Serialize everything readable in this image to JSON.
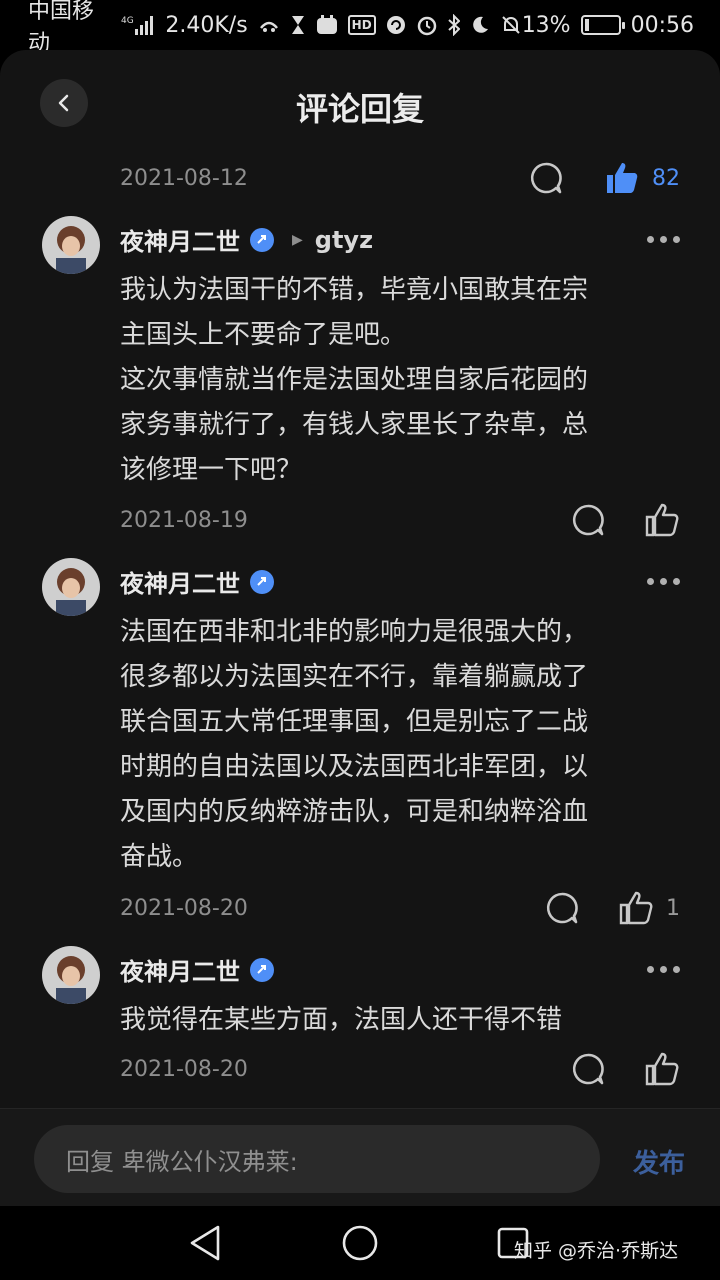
{
  "status_bar": {
    "carrier": "中国移动",
    "network": "4G",
    "speed": "2.40K/s",
    "hd": "HD",
    "battery_percent": "13%",
    "battery_level": 0.13,
    "time": "00:56"
  },
  "header": {
    "title": "评论回复"
  },
  "root_comment": {
    "date": "2021-08-12",
    "like_count": "82"
  },
  "replies": [
    {
      "author": "夜神月二世",
      "reply_to": "gtyz",
      "lines": [
        "我认为法国干的不错，毕竟小国敢其在宗",
        "主国头上不要命了是吧。",
        "这次事情就当作是法国处理自家后花园的",
        "家务事就行了，有钱人家里长了杂草，总",
        "该修理一下吧？"
      ],
      "date": "2021-08-19",
      "like_count": ""
    },
    {
      "author": "夜神月二世",
      "reply_to": "",
      "lines": [
        "法国在西非和北非的影响力是很强大的，",
        "很多都以为法国实在不行，靠着躺赢成了",
        "联合国五大常任理事国，但是别忘了二战",
        "时期的自由法国以及法国西北非军团，以",
        "及国内的反纳粹游击队，可是和纳粹浴血",
        "奋战。"
      ],
      "date": "2021-08-20",
      "like_count": "1"
    },
    {
      "author": "夜神月二世",
      "reply_to": "",
      "lines": [
        "我觉得在某些方面，法国人还干得不错"
      ],
      "date": "2021-08-20",
      "like_count": ""
    }
  ],
  "input": {
    "placeholder": "回复 卑微公仆汉弗莱:",
    "publish_label": "发布"
  },
  "watermark": "知乎 @乔治·乔斯达",
  "colors": {
    "accent": "#4f8ff7",
    "background": "#141414"
  }
}
